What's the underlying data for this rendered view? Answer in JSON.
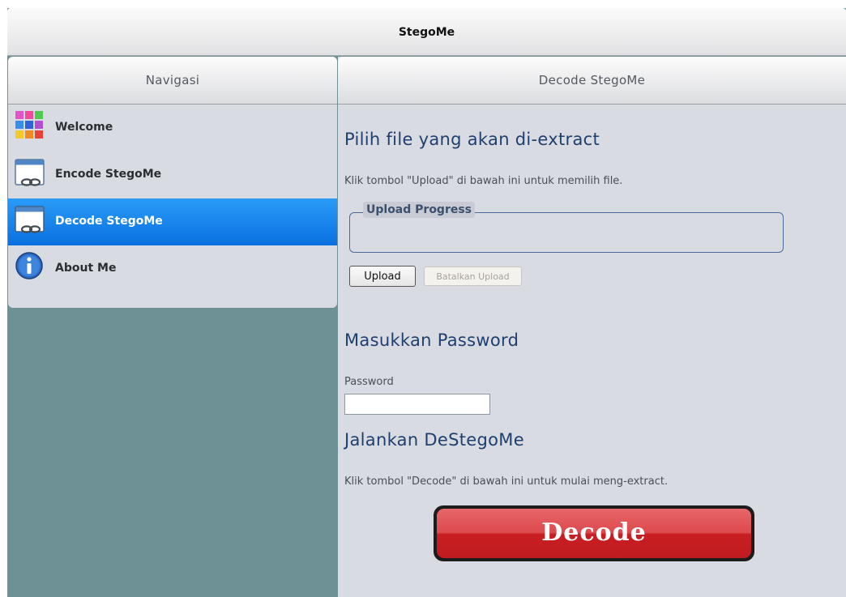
{
  "app": {
    "title": "StegoMe"
  },
  "sidebar": {
    "header": "Navigasi",
    "items": [
      {
        "label": "Welcome",
        "icon": "grid-icon"
      },
      {
        "label": "Encode StegoMe",
        "icon": "window-link-icon"
      },
      {
        "label": "Decode StegoMe",
        "icon": "window-link-icon",
        "active": true
      },
      {
        "label": "About Me",
        "icon": "info-icon"
      }
    ]
  },
  "main": {
    "header": "Decode StegoMe",
    "section1": {
      "title": "Pilih file yang akan di-extract",
      "hint": "Klik tombol \"Upload\" di bawah ini untuk memilih file.",
      "legend": "Upload Progress",
      "upload_label": "Upload",
      "cancel_label": "Batalkan Upload"
    },
    "section2": {
      "title": "Masukkan Password",
      "password_label": "Password",
      "password_value": ""
    },
    "section3": {
      "title": "Jalankan DeStegoMe",
      "hint": "Klik tombol \"Decode\" di bawah ini untuk mulai meng-extract.",
      "decode_label": "Decode"
    }
  },
  "colors": {
    "active_nav": "#0a6fe0",
    "heading": "#1f3f6e",
    "decode_button": "#c81e22",
    "background": "#6e9196"
  }
}
